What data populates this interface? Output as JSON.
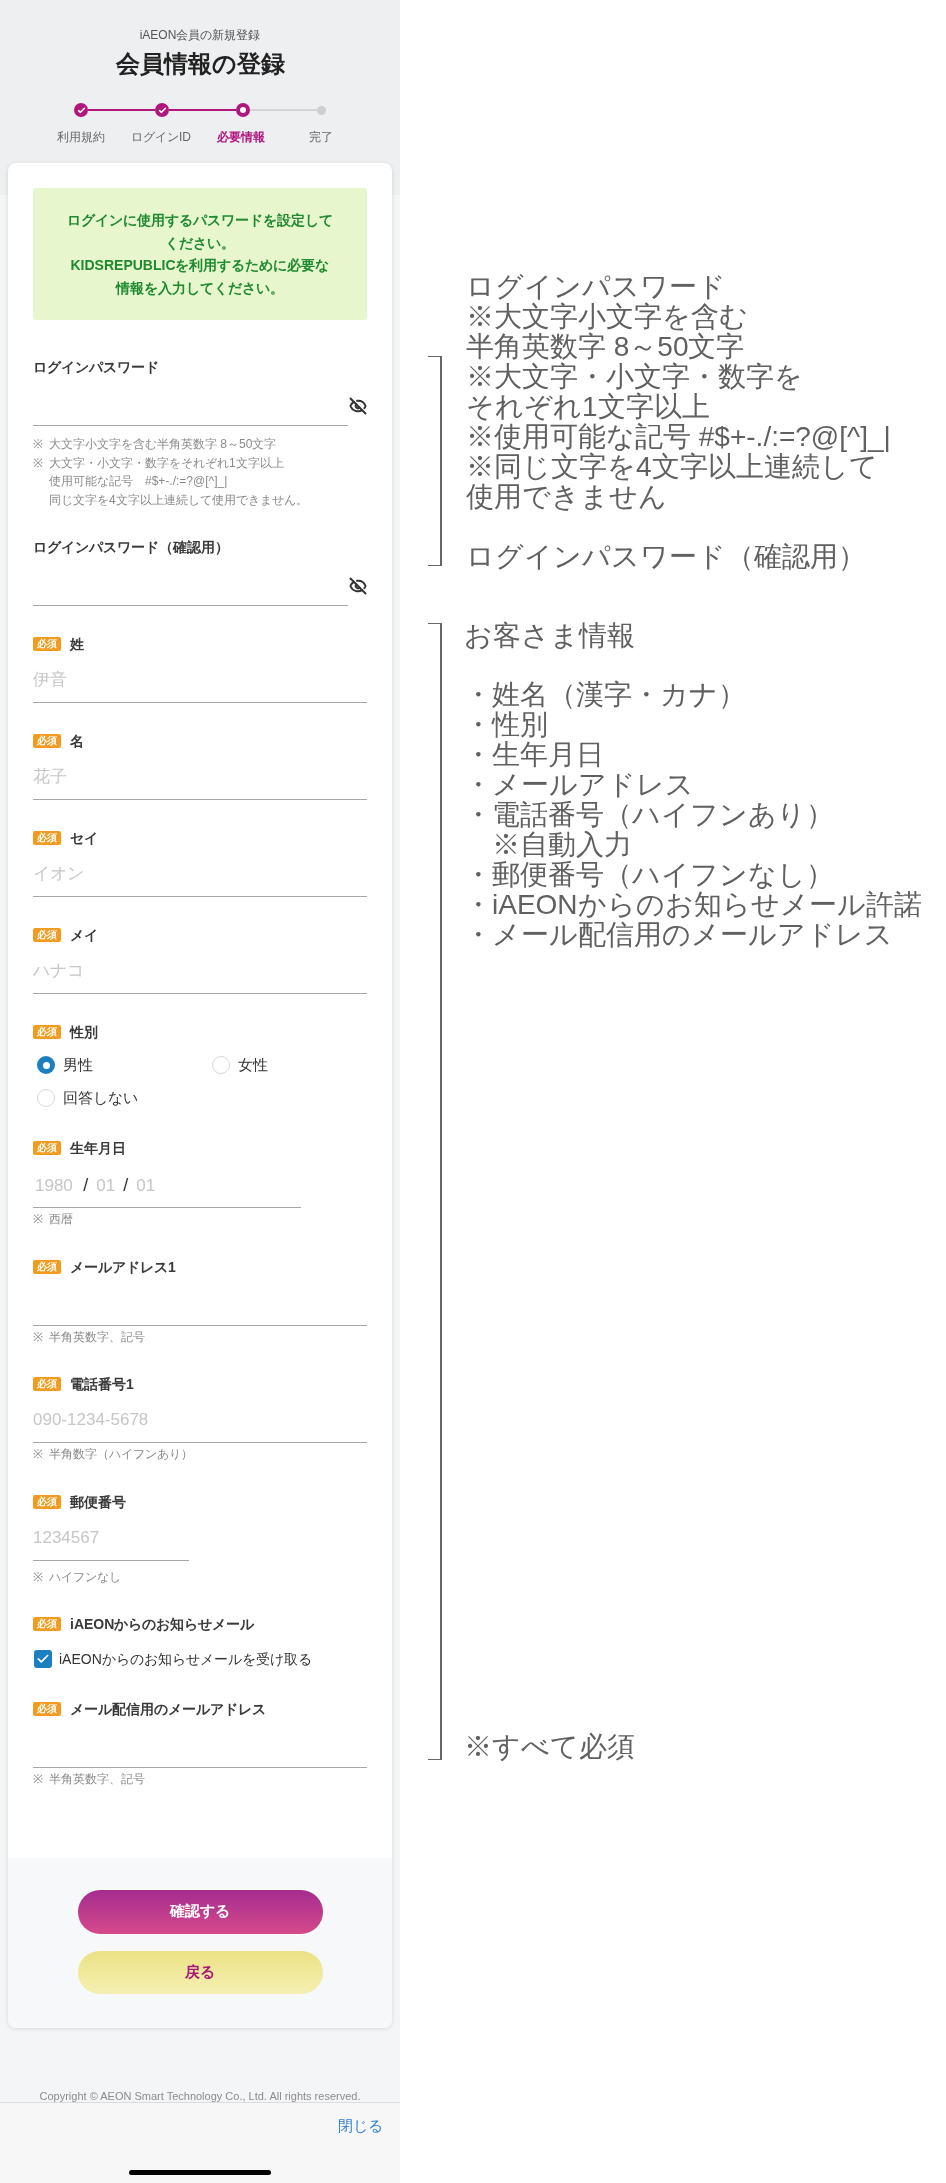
{
  "header": {
    "subtitle": "iAEON会員の新規登録",
    "title": "会員情報の登録"
  },
  "steps": [
    {
      "label": "利用規約",
      "completed": true,
      "selected": false
    },
    {
      "label": "ログインID",
      "completed": true,
      "selected": false
    },
    {
      "label": "必要情報",
      "completed": false,
      "selected": true
    },
    {
      "label": "完了",
      "completed": false,
      "selected": false
    }
  ],
  "notice": [
    "ログインに使用するパスワードを設定してください。",
    "KIDSREPUBLICを利用するために必要な情報を入力してください。"
  ],
  "fields": [
    {
      "kind": "password",
      "label": "ログインパスワード",
      "notes": [
        {
          "mark": "※",
          "lines": [
            "大文字小文字を含む半角英数字 8～50文字"
          ]
        },
        {
          "mark": "※",
          "lines": [
            "大文字・小文字・数字をそれぞれ1文字以上",
            "使用可能な記号　#$+-./:=?@[^]_|",
            "同じ文字を4文字以上連続して使用できません。"
          ]
        }
      ]
    },
    {
      "kind": "password",
      "label": "ログインパスワード（確認用）"
    },
    {
      "kind": "text",
      "badge": "必須",
      "label": "姓",
      "placeholder": "伊音"
    },
    {
      "kind": "text",
      "badge": "必須",
      "label": "名",
      "placeholder": "花子"
    },
    {
      "kind": "text",
      "badge": "必須",
      "label": "セイ",
      "placeholder": "イオン"
    },
    {
      "kind": "text",
      "badge": "必須",
      "label": "メイ",
      "placeholder": "ハナコ"
    },
    {
      "kind": "radio",
      "badge": "必須",
      "label": "性別",
      "options": [
        {
          "label": "男性",
          "selected": true
        },
        {
          "label": "女性",
          "selected": false
        },
        {
          "label": "回答しない",
          "selected": false
        }
      ]
    },
    {
      "kind": "date",
      "badge": "必須",
      "label": "生年月日",
      "segments": [
        {
          "kind": "input",
          "placeholder": "1980"
        },
        {
          "kind": "separator",
          "text": "/"
        },
        {
          "kind": "input",
          "placeholder": "01"
        },
        {
          "kind": "separator",
          "text": "/"
        },
        {
          "kind": "input",
          "placeholder": "01"
        }
      ],
      "notes": [
        {
          "mark": "※",
          "lines": [
            "西暦"
          ]
        }
      ]
    },
    {
      "kind": "text",
      "badge": "必須",
      "label": "メールアドレス1",
      "notes": [
        {
          "mark": "※",
          "lines": [
            "半角英数字、記号"
          ]
        }
      ]
    },
    {
      "kind": "text",
      "badge": "必須",
      "label": "電話番号1",
      "placeholder": "090-1234-5678",
      "notes": [
        {
          "mark": "※",
          "lines": [
            "半角数字（ハイフンあり）"
          ]
        }
      ]
    },
    {
      "kind": "short_text",
      "badge": "必須",
      "label": "郵便番号",
      "placeholder": "1234567",
      "notes": [
        {
          "mark": "※",
          "lines": [
            "ハイフンなし"
          ]
        }
      ]
    },
    {
      "kind": "checkbox",
      "badge": "必須",
      "label": "iAEONからのお知らせメール",
      "option": {
        "label": "iAEONからのお知らせメールを受け取る",
        "checked": true
      }
    },
    {
      "kind": "text",
      "badge": "必須",
      "label": "メール配信用のメールアドレス",
      "notes": [
        {
          "mark": "※",
          "lines": [
            "半角英数字、記号"
          ]
        }
      ]
    }
  ],
  "actions": [
    {
      "kind": "primary",
      "label": "確認する"
    },
    {
      "kind": "secondary",
      "label": "戻る"
    }
  ],
  "copyright": "Copyright © AEON Smart Technology Co., Ltd. All rights reserved.",
  "toolbar": {
    "close": "閉じる"
  },
  "annotations": {
    "password_block": {
      "paragraphs": [
        {
          "lines": [
            "ログインパスワード",
            "※大文字小文字を含む",
            "半角英数字 8～50文字",
            "※大文字・小文字・数字を",
            "それぞれ1文字以上",
            "※使用可能な記号 #$+-./:=?@[^]_|",
            "※同じ文字を4文字以上連続して",
            "使用できません"
          ]
        },
        {
          "lines": [
            "ログインパスワード（確認用）"
          ]
        }
      ]
    },
    "customer_block": {
      "title": "お客さま情報",
      "items": [
        {
          "text": "・姓名（漢字・カナ）"
        },
        {
          "text": "・性別"
        },
        {
          "text": "・生年月日"
        },
        {
          "text": "・メールアドレス"
        },
        {
          "text": "・電話番号（ハイフンあり）",
          "children": [
            {
              "text": "※自動入力"
            }
          ]
        },
        {
          "text": "・郵便番号（ハイフンなし）"
        },
        {
          "text": "・iAEONからのお知らせメール許諾"
        },
        {
          "text": "・メール配信用のメールアドレス"
        }
      ],
      "footer": "※すべて必須"
    }
  }
}
